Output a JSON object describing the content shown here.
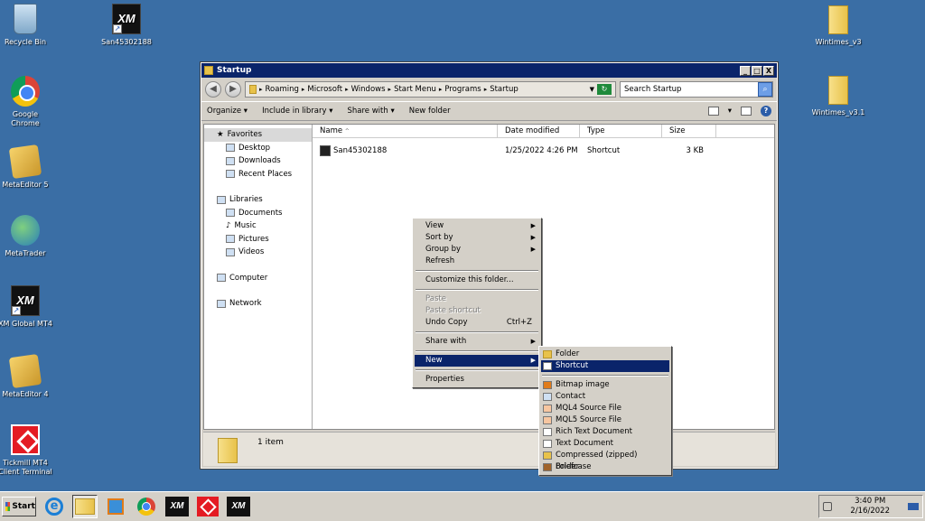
{
  "desktop": {
    "icons": [
      {
        "label": "Recycle Bin"
      },
      {
        "label": "San45302188"
      },
      {
        "label": "Google Chrome"
      },
      {
        "label": "MetaEditor 5"
      },
      {
        "label": "MetaTrader"
      },
      {
        "label": "XM Global MT4"
      },
      {
        "label": "MetaEditor 4"
      },
      {
        "label": "Tickmill MT4 Client Terminal"
      },
      {
        "label": "Wintimes_v3"
      },
      {
        "label": "Wintimes_v3.1"
      }
    ],
    "xm_logo_text": "XM"
  },
  "window": {
    "title": "Startup",
    "controls": {
      "min": "_",
      "max": "□",
      "close": "X"
    },
    "address": [
      "Roaming",
      "Microsoft",
      "Windows",
      "Start Menu",
      "Programs",
      "Startup"
    ],
    "search_placeholder": "Search Startup",
    "toolbar": {
      "organize": "Organize",
      "include": "Include in library",
      "share": "Share with",
      "new_folder": "New folder"
    },
    "nav": {
      "favorites": "Favorites",
      "desktop": "Desktop",
      "downloads": "Downloads",
      "recent": "Recent Places",
      "libraries": "Libraries",
      "documents": "Documents",
      "music": "Music",
      "pictures": "Pictures",
      "videos": "Videos",
      "computer": "Computer",
      "network": "Network"
    },
    "columns": {
      "name": "Name",
      "date": "Date modified",
      "type": "Type",
      "size": "Size"
    },
    "files": [
      {
        "name": "San45302188",
        "date": "1/25/2022 4:26 PM",
        "type": "Shortcut",
        "size": "3 KB"
      }
    ],
    "status": "1 item"
  },
  "context_menu": {
    "view": "View",
    "sort_by": "Sort by",
    "group_by": "Group by",
    "refresh": "Refresh",
    "customize": "Customize this folder...",
    "paste": "Paste",
    "paste_shortcut": "Paste shortcut",
    "undo_copy": "Undo Copy",
    "undo_shortcut": "Ctrl+Z",
    "share_with": "Share with",
    "new": "New",
    "properties": "Properties"
  },
  "new_submenu": {
    "folder": "Folder",
    "shortcut": "Shortcut",
    "bitmap": "Bitmap image",
    "contact": "Contact",
    "mql4": "MQL4 Source File",
    "mql5": "MQL5 Source File",
    "rtf": "Rich Text Document",
    "text": "Text Document",
    "zip": "Compressed (zipped) Folder",
    "briefcase": "Briefcase"
  },
  "taskbar": {
    "start": "Start",
    "time": "3:40 PM",
    "date": "2/16/2022",
    "xm_text": "XM",
    "ie_glyph": "e"
  },
  "colors": {
    "desktop_bg": "#3a6ea5",
    "title_bar": "#0a246a",
    "highlight": "#0a246a"
  }
}
